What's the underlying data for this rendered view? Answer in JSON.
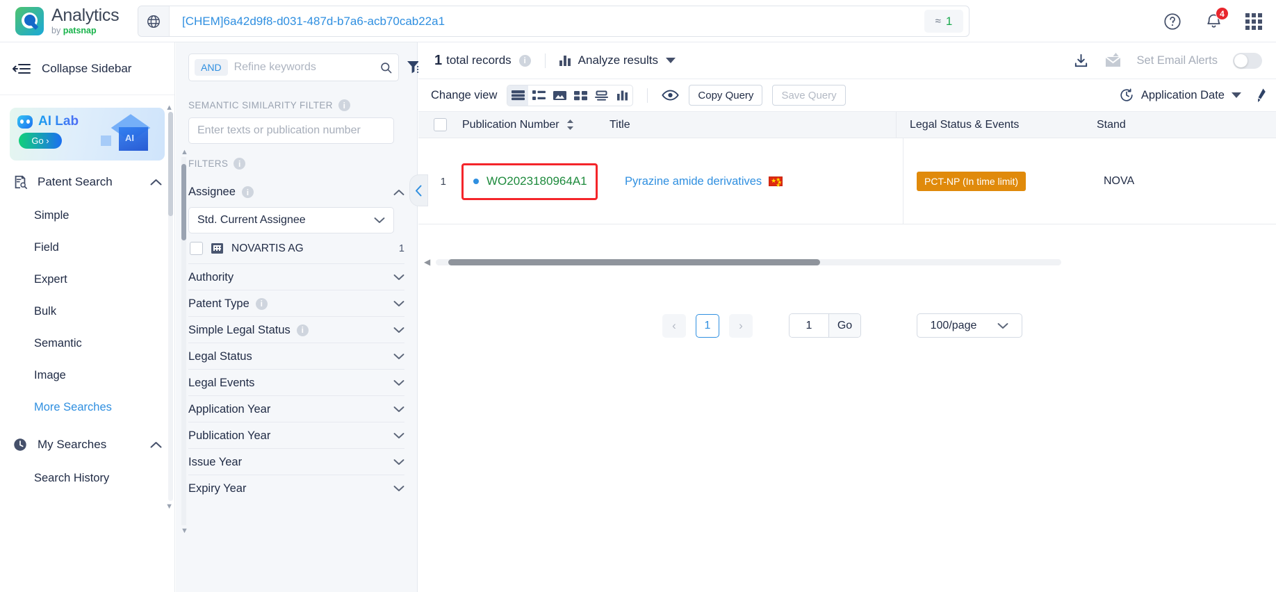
{
  "header": {
    "logo_title": "Analytics",
    "logo_sub_prefix": "by ",
    "logo_sub_brand": "patsnap",
    "query_value": "[CHEM]6a42d9f8-d031-487d-b7a6-acb70cab22a1",
    "approx_symbol": "≈",
    "approx_count": "1",
    "notification_count": "4"
  },
  "sidebar": {
    "collapse_label": "Collapse Sidebar",
    "ai_card": {
      "title": "AI Lab",
      "button": "Go ›"
    },
    "groups": [
      {
        "label": "Patent Search",
        "items": [
          {
            "label": "Simple",
            "link": false
          },
          {
            "label": "Field",
            "link": false
          },
          {
            "label": "Expert",
            "link": false
          },
          {
            "label": "Bulk",
            "link": false
          },
          {
            "label": "Semantic",
            "link": false
          },
          {
            "label": "Image",
            "link": false
          },
          {
            "label": "More Searches",
            "link": true
          }
        ]
      },
      {
        "label": "My Searches",
        "items": [
          {
            "label": "Search History",
            "link": false
          }
        ]
      }
    ]
  },
  "filters": {
    "and_chip": "AND",
    "refine_placeholder": "Refine keywords",
    "semantic_label": "SEMANTIC SIMILARITY FILTER",
    "semantic_placeholder": "Enter texts or publication number",
    "filters_label": "FILTERS",
    "assignee_label": "Assignee",
    "assignee_select_value": "Std. Current Assignee",
    "assignee_item": "NOVARTIS AG",
    "assignee_item_count": "1",
    "facets": [
      {
        "label": "Authority",
        "info": false
      },
      {
        "label": "Patent Type",
        "info": true
      },
      {
        "label": "Simple Legal Status",
        "info": true
      },
      {
        "label": "Legal Status",
        "info": false
      },
      {
        "label": "Legal Events",
        "info": false
      },
      {
        "label": "Application Year",
        "info": false
      },
      {
        "label": "Publication Year",
        "info": false
      },
      {
        "label": "Issue Year",
        "info": false
      },
      {
        "label": "Expiry Year",
        "info": false
      }
    ]
  },
  "results": {
    "total_count": "1",
    "total_label": "total records",
    "analyze_label": "Analyze results",
    "email_alerts_label": "Set Email Alerts",
    "change_view_label": "Change view",
    "copy_query_label": "Copy Query",
    "save_query_label": "Save Query",
    "sort_label": "Application Date"
  },
  "table": {
    "columns": [
      {
        "key": "publication_number",
        "label": "Publication Number",
        "sortable": true
      },
      {
        "key": "title",
        "label": "Title",
        "sortable": false
      },
      {
        "key": "legal_status",
        "label": "Legal Status & Events",
        "sortable": false
      },
      {
        "key": "standardized",
        "label": "Stand",
        "sortable": false
      }
    ],
    "rows": [
      {
        "index": "1",
        "publication_number": "WO2023180964A1",
        "title": "Pyrazine amide derivatives",
        "flag": "CN",
        "legal_status": "PCT-NP (In time limit)",
        "standardized": "NOVA"
      }
    ]
  },
  "pagination": {
    "prev": "‹",
    "current_page": "1",
    "next": "›",
    "goto_value": "1",
    "go_label": "Go",
    "page_size": "100/page"
  },
  "colors": {
    "accent_blue": "#2f8fe0",
    "green": "#1d8a3c",
    "orange": "#e08a0b",
    "highlight_red": "#f4252a",
    "badge_red": "#e8262d"
  }
}
